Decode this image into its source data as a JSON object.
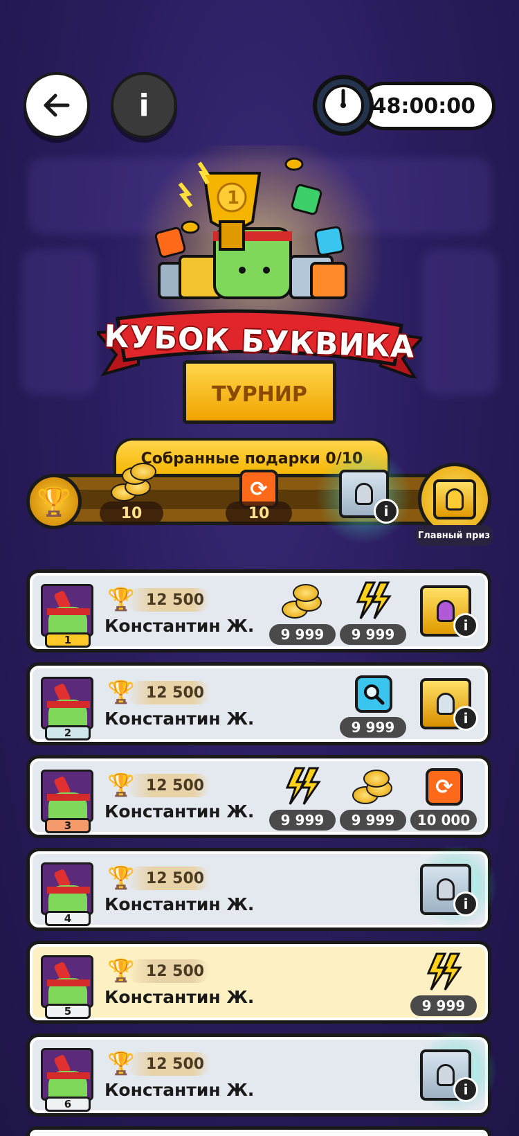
{
  "header": {
    "back_icon": "arrow-left-icon",
    "info_label": "i",
    "timer": "48:00:00"
  },
  "event": {
    "title": "КУБОК БУКВИКА",
    "subtitle": "ТУРНИР"
  },
  "progress": {
    "gifts_label": "Собранные подарки 0/10",
    "fill_fraction": 0.05,
    "milestones": [
      {
        "type": "coins",
        "amount": "10"
      },
      {
        "type": "refresh",
        "amount": "10"
      },
      {
        "type": "silver-chest",
        "info": "i"
      }
    ],
    "main_prize_label": "Главный приз"
  },
  "leaderboard": [
    {
      "rank": "1",
      "score": "12 500",
      "name": "Константин Ж.",
      "rewards": [
        {
          "kind": "coins",
          "value": "9 999"
        },
        {
          "kind": "lightning",
          "value": "9 999"
        },
        {
          "kind": "chest-purple",
          "info": "i"
        }
      ]
    },
    {
      "rank": "2",
      "score": "12 500",
      "name": "Константин Ж.",
      "rewards": [
        {
          "kind": "magnifier",
          "value": "9 999"
        },
        {
          "kind": "chest-royal",
          "info": "i"
        }
      ]
    },
    {
      "rank": "3",
      "score": "12 500",
      "name": "Константин Ж.",
      "rewards": [
        {
          "kind": "lightning",
          "value": "9 999"
        },
        {
          "kind": "coins",
          "value": "9 999"
        },
        {
          "kind": "refresh",
          "value": "10 000"
        }
      ]
    },
    {
      "rank": "4",
      "score": "12 500",
      "name": "Константин Ж.",
      "rewards": [
        {
          "kind": "chest-silver",
          "info": "i"
        }
      ]
    },
    {
      "rank": "5",
      "score": "12 500",
      "name": "Константин Ж.",
      "highlight": true,
      "rewards": [
        {
          "kind": "lightning",
          "value": "9 999"
        }
      ]
    },
    {
      "rank": "6",
      "score": "12 500",
      "name": "Константин Ж.",
      "rewards": [
        {
          "kind": "chest-silver",
          "info": "i"
        }
      ]
    }
  ],
  "colors": {
    "background": "#2a1d5e",
    "ribbon": "#e0262b",
    "gold": "#f5b400",
    "row": "#e4e8ef",
    "row_highlight": "#fdf1c4"
  }
}
